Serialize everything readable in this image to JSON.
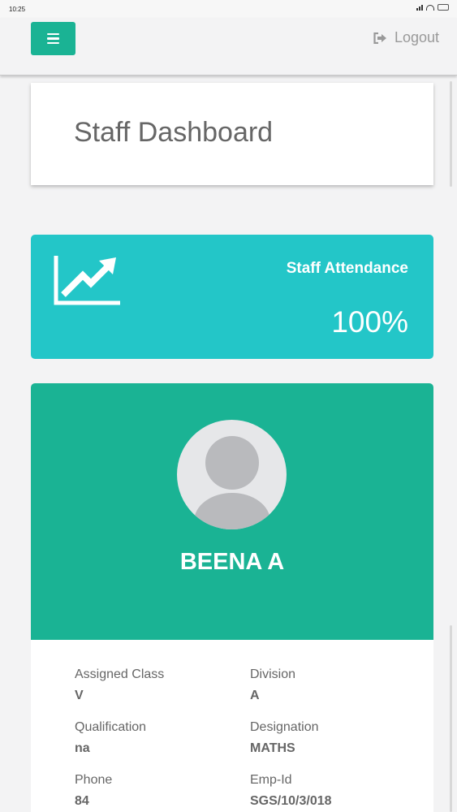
{
  "status_bar": {
    "time": "10:25"
  },
  "navbar": {
    "logout_label": "Logout"
  },
  "header": {
    "title": "Staff Dashboard"
  },
  "attendance": {
    "label": "Staff Attendance",
    "value": "100%"
  },
  "profile": {
    "name": "BEENA A"
  },
  "details": {
    "assigned_class_label": "Assigned Class",
    "assigned_class_value": "V",
    "division_label": "Division",
    "division_value": "A",
    "qualification_label": "Qualification",
    "qualification_value": "na",
    "designation_label": "Designation",
    "designation_value": "MATHS",
    "phone_label": "Phone",
    "phone_value": "84",
    "emp_id_label": "Emp-Id",
    "emp_id_value": "SGS/10/3/018"
  },
  "colors": {
    "primary": "#1ab394",
    "attendance": "#23c6c8"
  }
}
